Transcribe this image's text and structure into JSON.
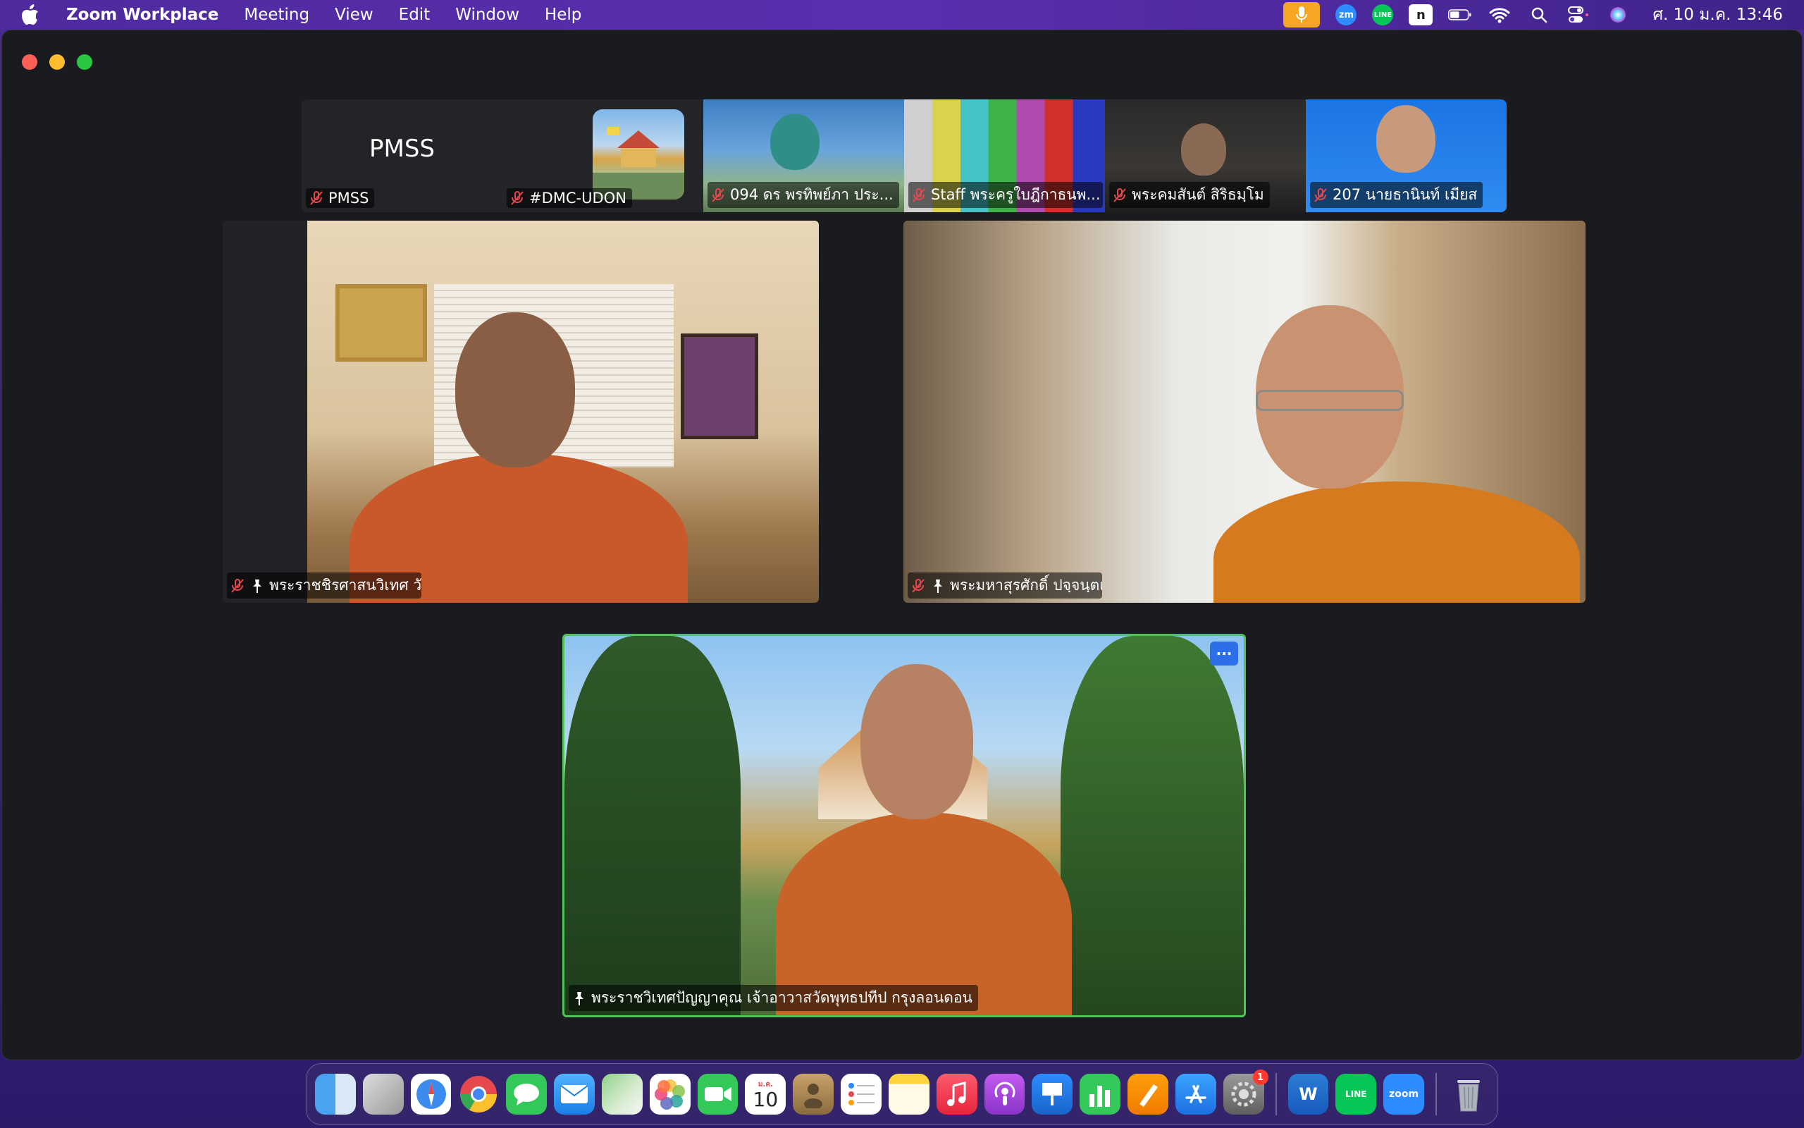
{
  "menubar": {
    "app_name": "Zoom Workplace",
    "items": [
      "Meeting",
      "View",
      "Edit",
      "Window",
      "Help"
    ],
    "clock": "ศ. 10 ม.ค.  13:46",
    "status_icons": [
      "mic-in-use-icon",
      "zoom-icon",
      "line-icon",
      "n-icon",
      "battery-icon",
      "wifi-icon",
      "spotlight-search-icon",
      "control-center-icon",
      "siri-icon"
    ],
    "zm_label": "zm",
    "line_label": "LINE",
    "n_label": "n"
  },
  "strip": {
    "tiles": [
      {
        "label": "PMSS",
        "name": "PMSS",
        "muted": true
      },
      {
        "name": "#DMC-UDON",
        "muted": true,
        "has_avatar": true
      },
      {
        "name": "094 ดร พรทิพย์ภา ประ...",
        "muted": true
      },
      {
        "name": "Staff พระครูใบฎีกาธนพ...",
        "muted": true
      },
      {
        "name": "พระคมสันต์ สิริธมฺโม",
        "muted": true
      },
      {
        "name": "207 นายธานินท์ เมียส",
        "muted": true
      }
    ]
  },
  "main_tiles": [
    {
      "name": "พระราชชิรศาสนวิเทศ วัดไทยนอร์เวย์",
      "muted": true,
      "pinned": true
    },
    {
      "name": "พระมหาสุรศักดิ์ ปจฺจนฺตเสโน, ผศ.ดร.",
      "muted": true,
      "pinned": true
    },
    {
      "name": "พระราชวิเทศปัญญาคุณ เจ้าอาวาสวัดพุทธปทีป กรุงลอนดอน",
      "muted": false,
      "pinned": true,
      "active_speaker": true
    }
  ],
  "options_label": "···",
  "dock": {
    "apps": [
      "Finder",
      "Launchpad",
      "Safari",
      "Chrome",
      "Messages",
      "Mail",
      "Maps",
      "Photos",
      "FaceTime",
      "Calendar",
      "Contacts",
      "Reminders",
      "Notes",
      "Music",
      "Podcasts",
      "Keynote",
      "Numbers",
      "Pages",
      "App Store",
      "System Settings",
      "Word",
      "LINE",
      "Zoom",
      "Trash"
    ],
    "calendar_day": "10",
    "calendar_month": "ม.ค.",
    "settings_badge": "1",
    "word_label": "W",
    "line_label": "LINE",
    "zoom_label": "zoom"
  },
  "colors": {
    "active_speaker_border": "#52c25a",
    "muted_red": "#e5484d",
    "zoom_blue": "#2d8cff"
  }
}
